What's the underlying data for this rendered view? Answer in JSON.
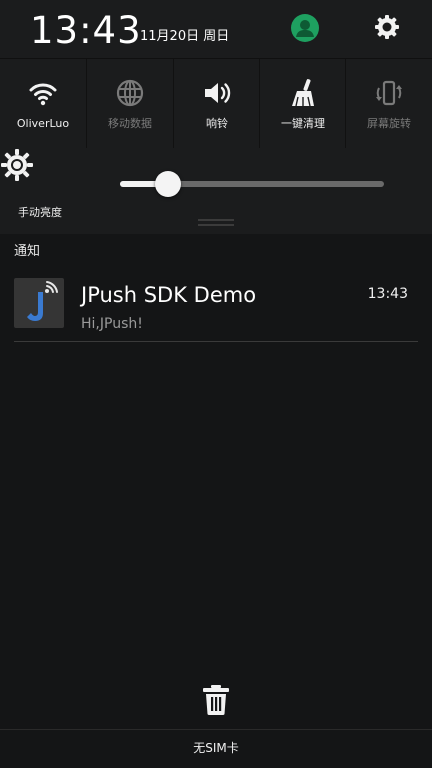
{
  "status": {
    "time": "13:43",
    "date": "11月20日 周日"
  },
  "header": {
    "avatar_icon": "user-avatar-icon",
    "settings_icon": "gear-icon",
    "avatar_color": "#1ea060"
  },
  "toggles": [
    {
      "label": "OliverLuo",
      "icon": "wifi-icon",
      "active": true
    },
    {
      "label": "移动数据",
      "icon": "globe-icon",
      "active": false
    },
    {
      "label": "响铃",
      "icon": "speaker-icon",
      "active": true
    },
    {
      "label": "一键清理",
      "icon": "broom-icon",
      "active": true
    },
    {
      "label": "屏幕旋转",
      "icon": "rotate-phone-icon",
      "active": false
    }
  ],
  "brightness": {
    "label": "手动亮度",
    "icon": "brightness-icon",
    "level": 0.18
  },
  "notifications": {
    "section_title": "通知",
    "items": [
      {
        "app_icon": "jpush-app-icon",
        "title": "JPush SDK Demo",
        "time": "13:43",
        "body": "Hi,JPush!"
      }
    ]
  },
  "footer": {
    "clear_icon": "trash-icon",
    "sim_text": "无SIM卡"
  }
}
